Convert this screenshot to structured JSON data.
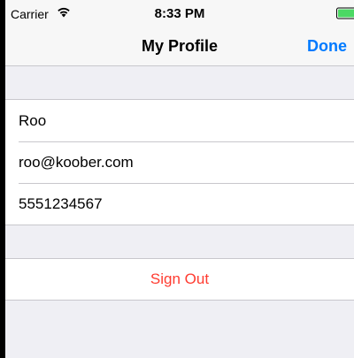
{
  "status_bar": {
    "carrier": "Carrier",
    "time": "8:33 PM",
    "wifi_icon": "wifi-icon",
    "battery_icon": "battery-charging-icon",
    "battery_color": "#4cd964"
  },
  "nav": {
    "title": "My Profile",
    "done_label": "Done",
    "accent_color": "#007aff"
  },
  "profile": {
    "name": "Roo",
    "email": "roo@koober.com",
    "phone": "5551234567"
  },
  "actions": {
    "sign_out_label": "Sign Out",
    "destructive_color": "#ff3b30"
  }
}
